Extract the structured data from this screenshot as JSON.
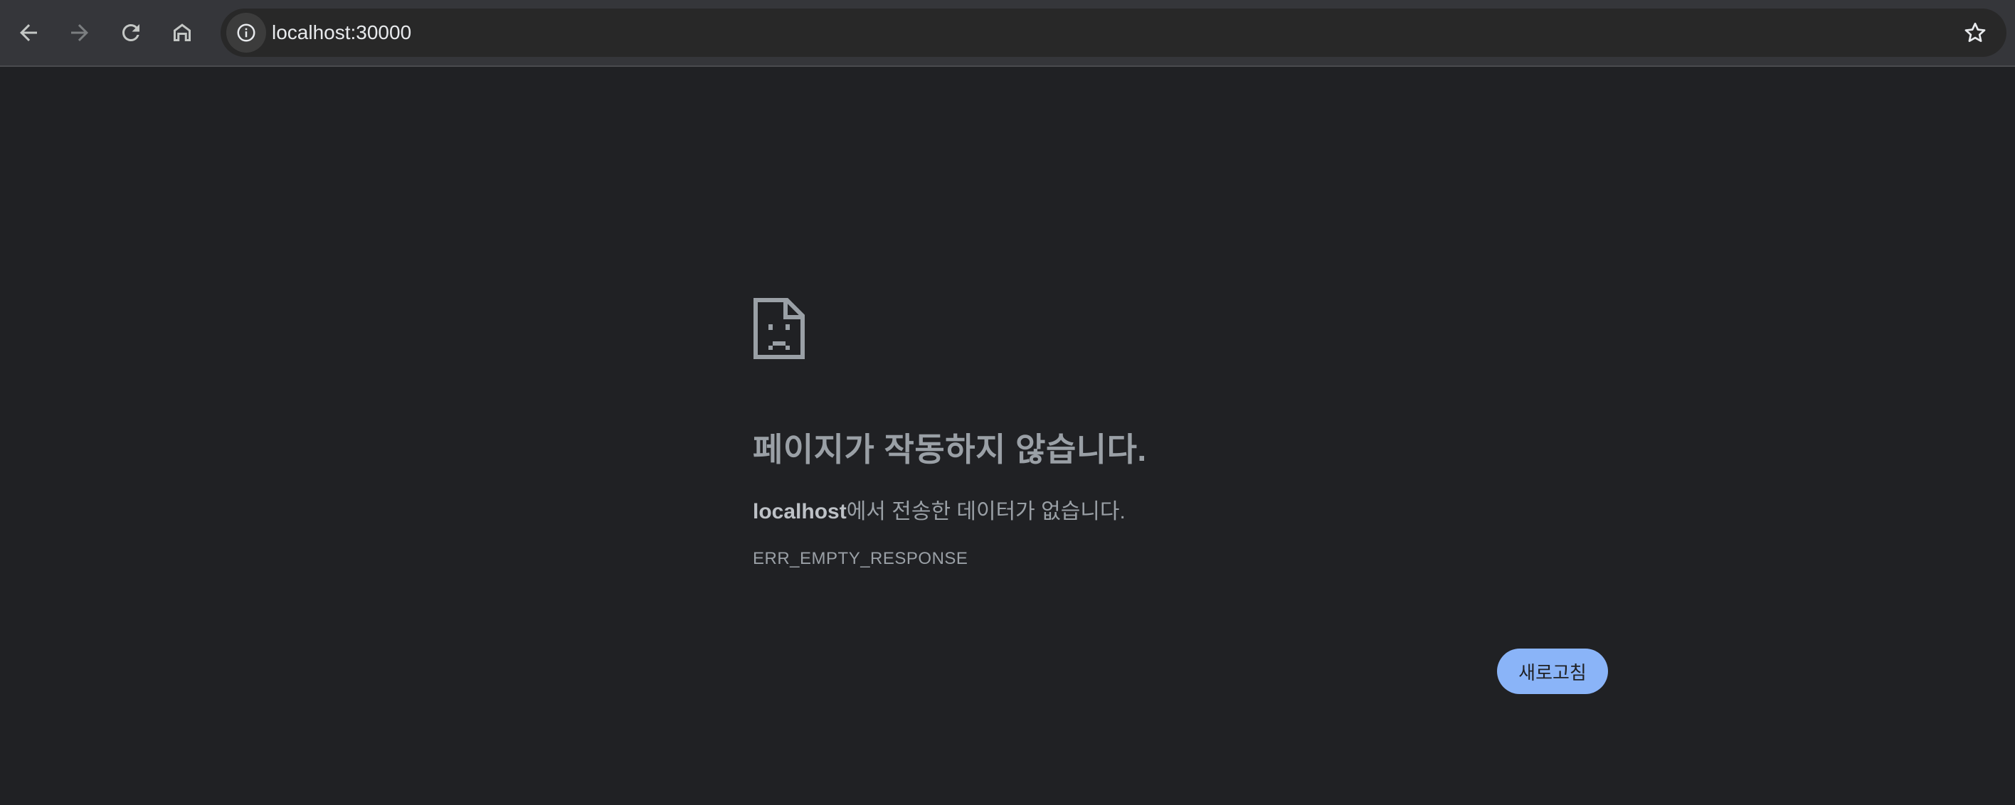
{
  "browser": {
    "url": "localhost:30000",
    "icons": {
      "back": "arrow-left-icon",
      "forward": "arrow-right-icon",
      "reload": "reload-icon",
      "home": "home-icon",
      "site_info": "info-icon",
      "bookmark": "star-icon"
    }
  },
  "error_page": {
    "icon": "sad-page-icon",
    "title": "페이지가 작동하지 않습니다.",
    "host": "localhost",
    "desc_suffix": "에서 전송한 데이터가 없습니다.",
    "code": "ERR_EMPTY_RESPONSE",
    "reload_label": "새로고침"
  },
  "colors": {
    "background": "#202124",
    "toolbar": "#35363a",
    "accent_button": "#8ab4f8",
    "text_secondary": "#9aa0a6"
  }
}
